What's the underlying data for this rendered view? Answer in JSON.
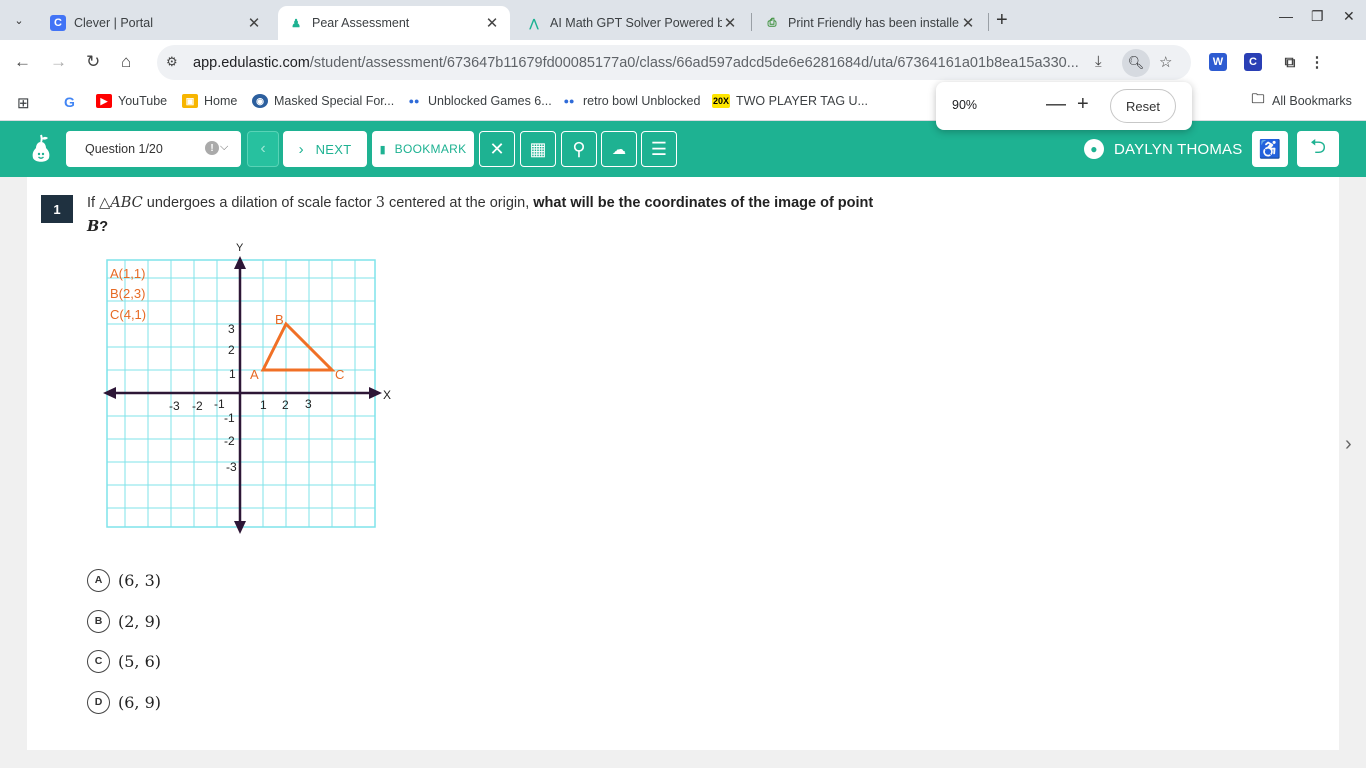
{
  "browser": {
    "tabs": [
      {
        "title": "Clever | Portal",
        "active": false
      },
      {
        "title": "Pear Assessment",
        "active": true
      },
      {
        "title": "AI Math GPT Solver Powered b",
        "active": false
      },
      {
        "title": "Print Friendly has been installe",
        "active": false
      }
    ],
    "url_domain": "app.edulastic.com",
    "url_path": "/student/assessment/673647b11679fd00085177a0/class/66ad597adcd5de6e6281684d/uta/67364161a01b8ea15a330...",
    "bookmarks": [
      "YouTube",
      "Home",
      "Masked Special For...",
      "Unblocked Games 6...",
      "retro bowl Unblocked",
      "TWO PLAYER TAG U..."
    ],
    "all_bookmarks": "All Bookmarks",
    "zoom": {
      "level": "90%",
      "reset_label": "Reset"
    }
  },
  "header": {
    "question_select": "Question 1/20",
    "next_label": "NEXT",
    "bookmark_label": "BOOKMARK",
    "user_name": "DAYLYN THOMAS",
    "accent": "#1eb292"
  },
  "question": {
    "number": "1",
    "text_prefix": "If ",
    "triangle": "△ABC",
    "text_mid": " undergoes a dilation of scale factor ",
    "factor": "3",
    "text_after": " centered at the origin, ",
    "bold_part": "what will be the coordinates of the image of point ",
    "point": "B",
    "end": "?"
  },
  "graph": {
    "axis_x_label": "X",
    "axis_y_label": "Y",
    "legend": [
      "A(1,1)",
      "B(2,3)",
      "C(4,1)"
    ],
    "x_ticks": [
      "-3",
      "-2",
      "-1",
      "1",
      "2",
      "3"
    ],
    "y_ticks": [
      "3",
      "2",
      "1",
      "-1",
      "-2",
      "-3"
    ],
    "vertex_labels": [
      "A",
      "B",
      "C"
    ],
    "triangle_color": "#f07026",
    "grid_color": "#7fe3ea",
    "points": [
      {
        "name": "A",
        "x": 1,
        "y": 1
      },
      {
        "name": "B",
        "x": 2,
        "y": 3
      },
      {
        "name": "C",
        "x": 4,
        "y": 1
      }
    ]
  },
  "choices": [
    {
      "letter": "A",
      "answer": "(6, 3)"
    },
    {
      "letter": "B",
      "answer": "(2, 9)"
    },
    {
      "letter": "C",
      "answer": "(5, 6)"
    },
    {
      "letter": "D",
      "answer": "(6, 9)"
    }
  ]
}
